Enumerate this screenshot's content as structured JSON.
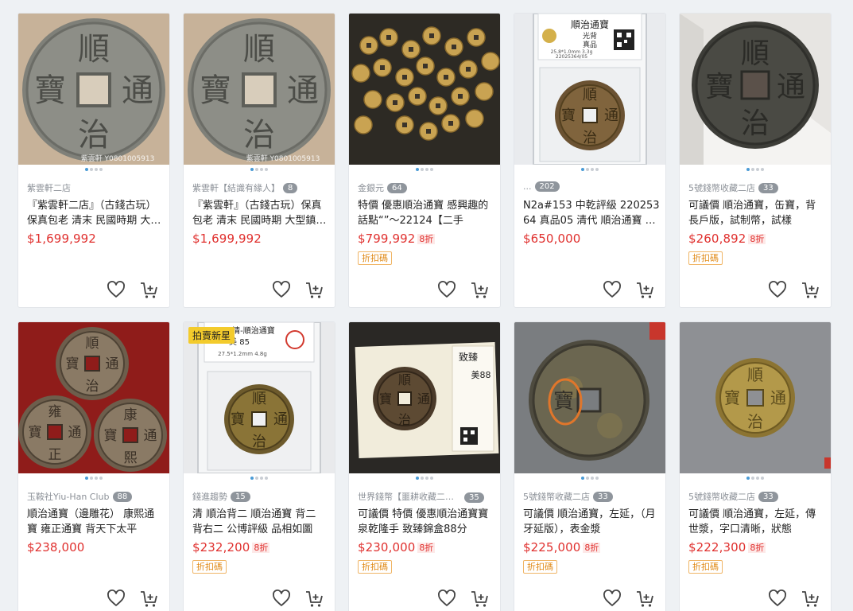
{
  "products": [
    {
      "shop": "紫雲軒二店",
      "count": "",
      "title": "『紫雲軒二店』（古錢古玩）保真包老 清末 民國時期 大型鎮庫錢 順治通寶",
      "price": "$1,699,992",
      "discount": "",
      "coupon": "",
      "watermark": "紫雲軒  Y0801005913",
      "overlay": "",
      "image": "large-gray-coin"
    },
    {
      "shop": "紫雲軒【結識有緣人】",
      "count": "8",
      "title": "『紫雲軒』（古錢古玩）保真包老 清末 民國時期 大型鎮庫錢 順治通寶",
      "price": "$1,699,992",
      "discount": "",
      "coupon": "",
      "watermark": "紫雲軒  Y0801005913",
      "overlay": "",
      "image": "large-gray-coin"
    },
    {
      "shop": "金銀元",
      "count": "64",
      "title": "特價 優惠順治通寶 感興趣的話點“”～22124【二手",
      "price": "$799,992",
      "discount": "8折",
      "coupon": "折扣碼",
      "watermark": "",
      "overlay": "",
      "image": "pile-of-coins"
    },
    {
      "shop": "...",
      "count": "202",
      "title": "N2a#153 中乾評級 22025364 真品05 清代 順治通寶 光背",
      "price": "$650,000",
      "discount": "",
      "coupon": "",
      "watermark": "",
      "overlay": "",
      "image": "graded-slab",
      "slab": {
        "head": "順治通寶",
        "sub": "光背",
        "grade": "真品",
        "spec": "25.8*1.0mm 3.3g",
        "serial": "22025364/05"
      }
    },
    {
      "shop": "5號錢幣收藏二店",
      "count": "33",
      "title": "可議價 順治通寶，缶寶，背長戶版，試制幣，試樣",
      "price": "$260,892",
      "discount": "8折",
      "coupon": "折扣碼",
      "watermark": "",
      "overlay": "",
      "image": "dark-coin-stand"
    },
    {
      "shop": "玉鞍社Yiu-Han Club",
      "count": "88",
      "title": "順治通寶（邊雕花） 康熙通寶 雍正通寶 背天下太平",
      "price": "$238,000",
      "discount": "",
      "coupon": "",
      "watermark": "",
      "overlay": "",
      "image": "three-coins-red"
    },
    {
      "shop": "錢進趨勢",
      "count": "15",
      "title": "清 順治背二 順治通寶 背二 背右二 公博評級 品相如圖",
      "price": "$232,200",
      "discount": "8折",
      "coupon": "折扣碼",
      "watermark": "",
      "overlay": "拍賣新星",
      "image": "graded-slab-2",
      "slab": {
        "head": "清-順治通寶",
        "sub": "美 85",
        "spec": "27.5*1.2mm 4.8g"
      }
    },
    {
      "shop": "世界錢幣【噩耕收藏二店】",
      "count": "35",
      "title": "可議價 特價 優惠順治通寶寶泉乾隆手 致臻錦盒88分",
      "price": "$230,000",
      "discount": "8折",
      "coupon": "折扣碼",
      "watermark": "",
      "overlay": "",
      "image": "boxed-coin",
      "slab": {
        "head": "致臻",
        "sub": "美88"
      }
    },
    {
      "shop": "5號錢幣收藏二店",
      "count": "33",
      "title": "可議價 順治通寶，左延，（月牙延版），表金漿",
      "price": "$225,000",
      "discount": "8折",
      "coupon": "折扣碼",
      "watermark": "",
      "overlay": "",
      "image": "circled-coin"
    },
    {
      "shop": "5號錢幣收藏二店",
      "count": "33",
      "title": "可議價 順治通寶，左延，傳世漿，字口清晰，狀態",
      "price": "$222,300",
      "discount": "8折",
      "coupon": "折扣碼",
      "watermark": "",
      "overlay": "",
      "image": "gold-coin-gray"
    }
  ],
  "coin": {
    "top": "順",
    "right": "通",
    "bottom": "治",
    "left": "寶"
  },
  "coin_kangxi": {
    "top": "康",
    "right": "通",
    "bottom": "熙",
    "left": "寶"
  },
  "coin_yongzheng": {
    "top": "雍",
    "right": "通",
    "bottom": "正",
    "left": "寶"
  },
  "icons": {
    "favorite": "heart-icon",
    "cart": "add-to-cart-icon"
  },
  "colors": {
    "price": "#e0302e",
    "coupon": "#e08a17",
    "dot_active": "#4a9bd6",
    "badge": "#8f959c"
  }
}
